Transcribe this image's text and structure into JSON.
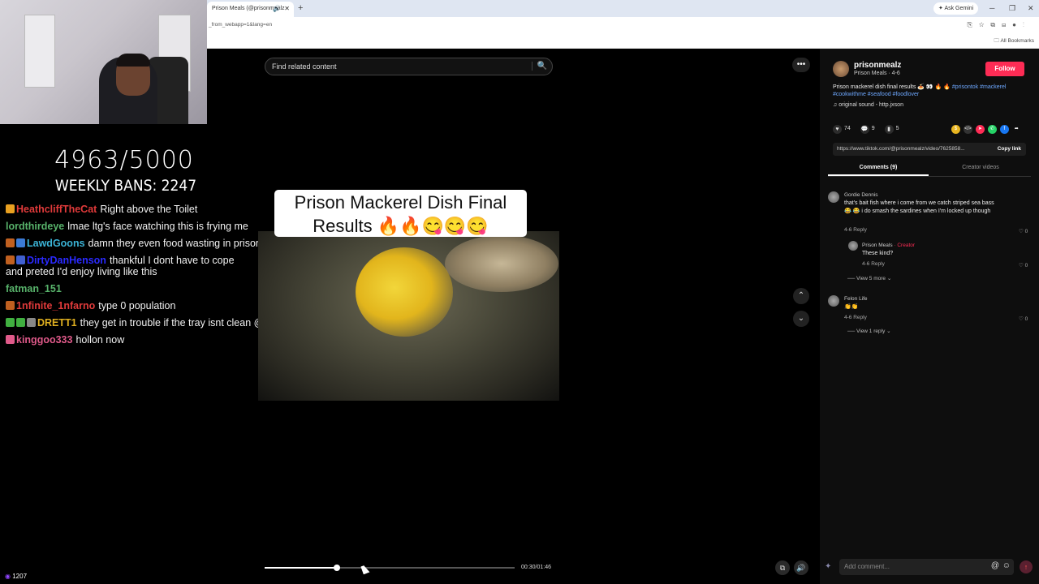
{
  "browser": {
    "tab_title": "Prison Meals (@prisonmealz",
    "new_tab_icon": "+",
    "ask_gemini": "Ask Gemini",
    "address": "_from_webapp=1&lang=en",
    "all_bookmarks": "All Bookmarks"
  },
  "stream": {
    "counter": "4963/5000",
    "weekly_bans": "WEEKLY BANS: 2247",
    "viewers": "1207",
    "chat": [
      {
        "user": "HeathcliffTheCat",
        "user_color": "#e03a3a",
        "text": "Right above the Toilet",
        "badges": [
          "#e8a020"
        ]
      },
      {
        "user": "lordthirdeye",
        "user_color": "#58b36b",
        "text": "lmae ltg's face watching this is frying me",
        "badges": []
      },
      {
        "user": "LawdGoons",
        "user_color": "#3bb3d6",
        "text": "damn they even food wasting in prison",
        "badges": [
          "#c06020",
          "#3b7bd6"
        ]
      },
      {
        "user": "DirtyDanHenson",
        "user_color": "#2a2aff",
        "text": "thankful I dont have to cope and preted I'd enjoy living like this",
        "badges": [
          "#c06020",
          "#4060d0"
        ]
      },
      {
        "user": "fatman_151",
        "user_color": "#58b36b",
        "text": "",
        "badges": []
      },
      {
        "user": "1nfinite_1nfarno",
        "user_color": "#e03a3a",
        "text": "type 0 population",
        "badges": [
          "#c06020"
        ]
      },
      {
        "user": "DRETT1",
        "user_color": "#e0b020",
        "text": "they get in trouble if the tray isnt clean @LowTierGod",
        "badges": [
          "#40b040",
          "#40b040",
          "#888"
        ]
      },
      {
        "user": "kinggoo333",
        "user_color": "#e05a8a",
        "text": "hollon now",
        "badges": [
          "#e05a8a"
        ]
      }
    ]
  },
  "video": {
    "search_placeholder": "Find related content",
    "title": "Prison Mackerel Dish Final Results 🔥🔥😋😋😋",
    "time": "00:30/01:46",
    "progress": 0.29
  },
  "panel": {
    "username": "prisonmealz",
    "subtitle": "Prison Meals · 4-6",
    "follow": "Follow",
    "description_text": "Prison mackerel dish final results 🍝 👀 🔥 🔥 ",
    "hashtags": "#prisontok #mackerel #cookwithme #seafood #foodlover",
    "sound": "original sound - http.jxson",
    "likes": "74",
    "comments": "9",
    "saves": "5",
    "link": "https://www.tiktok.com/@prisonmealz/video/7625858...",
    "copy_link": "Copy link",
    "tab_comments": "Comments (9)",
    "tab_creator": "Creator videos",
    "comment1": {
      "name": "Gordie Dennis",
      "text": "that's bait fish where i come from we catch striped sea bass 😂 😂 i do smash the sardines when I'm locked up though",
      "meta": "4-6   Reply",
      "likes": "0"
    },
    "reply1": {
      "name": "Prison Meals",
      "creator": " · Creator",
      "text": "These kind?",
      "meta": "4-6   Reply",
      "likes": "0"
    },
    "view_more": "View 5 more ⌄",
    "comment2": {
      "name": "Felon Life",
      "text": "👏👏",
      "meta": "4-6   Reply",
      "likes": "0"
    },
    "view_reply": "View 1 reply ⌄",
    "add_comment": "Add comment..."
  }
}
